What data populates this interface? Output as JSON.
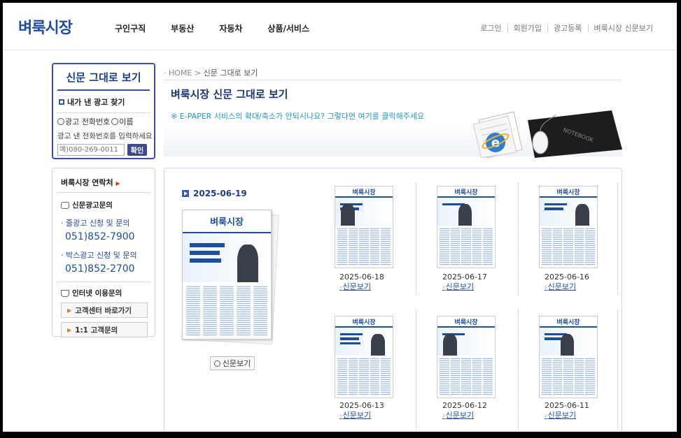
{
  "header": {
    "logo": "벼룩시장",
    "nav": [
      "구인구직",
      "부동산",
      "자동차",
      "상품/서비스"
    ],
    "util": [
      "로그인",
      "회원가입",
      "광고등록",
      "벼룩시장 신문보기"
    ]
  },
  "sidebar": {
    "find_box": {
      "title": "신문 그대로 보기",
      "subtitle": "내가 낸 광고 찾기",
      "radio_phone": "광고 전화번호",
      "radio_name": "이름",
      "hint": "광고 낸 전화번호를 입력하세요",
      "input_placeholder": "예)080-269-0011",
      "confirm": "확인"
    },
    "contact": {
      "title": "벼룩시장 연락처",
      "newspaper_ad": "신문광고문의",
      "line1_label": "줄광고 신청 및 문의",
      "line1_phone": "051)852-7900",
      "line2_label": "박스광고 신청 및 문의",
      "line2_phone": "051)852-2700",
      "internet": "인터넷 이용문의",
      "btn_center": "고객센터 바로가기",
      "btn_inquiry": "1:1 고객문의"
    }
  },
  "main": {
    "breadcrumb_home": "HOME",
    "breadcrumb_current": "신문 그대로 보기",
    "title": "벼룩시장 신문 그대로 보기",
    "note": "※ E-PAPER 서비스의 확대/축소가 안되시나요? 그렇다면 여기를 클릭해주세요",
    "banner_notebook": "NOTEBOOK",
    "featured_date": "2025-06-19",
    "featured_btn": "신문보기",
    "paper_logo": "벼룩시장",
    "thumbs": [
      {
        "date": "2025-06-18",
        "link": "신문보기"
      },
      {
        "date": "2025-06-17",
        "link": "신문보기"
      },
      {
        "date": "2025-06-16",
        "link": "신문보기"
      },
      {
        "date": "2025-06-13",
        "link": "신문보기"
      },
      {
        "date": "2025-06-12",
        "link": "신문보기"
      },
      {
        "date": "2025-06-11",
        "link": "신문보기"
      }
    ]
  },
  "colors": {
    "brand": "#1f4ea1",
    "accent_cyan": "#1e9bbf"
  }
}
